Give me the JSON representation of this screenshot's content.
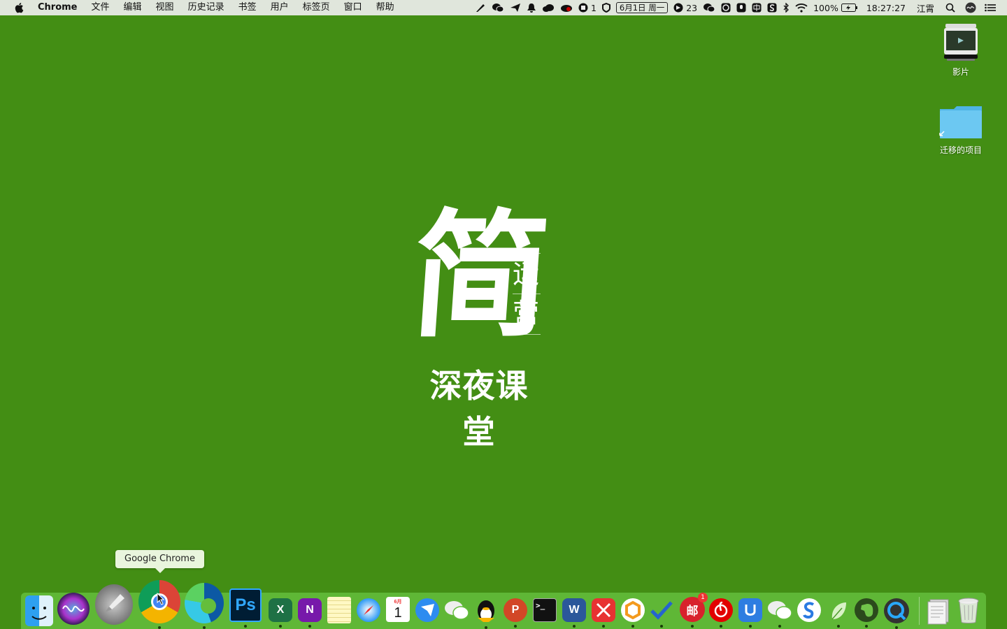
{
  "menubar": {
    "app_name": "Chrome",
    "menus": [
      "文件",
      "编辑",
      "视图",
      "历史记录",
      "书签",
      "用户",
      "标签页",
      "窗口",
      "帮助"
    ],
    "status": {
      "badge_one": "1",
      "date": "6月1日 周一",
      "count_23": "23",
      "battery": "100%",
      "time": "18:27:27",
      "input_method": "江霄"
    }
  },
  "desktop": {
    "movies_label": "影片",
    "migrated_label": "迁移的项目"
  },
  "wallpaper": {
    "big_char": "简",
    "vert_top": "运",
    "vert_bottom": "营",
    "subtitle": "深夜课堂"
  },
  "tooltip": "Google Chrome",
  "dock": {
    "ps_label": "Ps",
    "excel_label": "X",
    "onenote_label": "N",
    "ppt_label": "P",
    "word_label": "W",
    "calendar_month": "6月",
    "calendar_day": "1",
    "terminal_prompt": ">_",
    "netease_mail_label": "邮",
    "netease_mail_badge": "1"
  },
  "colors": {
    "wallpaper": "#438e14",
    "dock": "#64be3c",
    "menubar": "#eeeeee"
  }
}
